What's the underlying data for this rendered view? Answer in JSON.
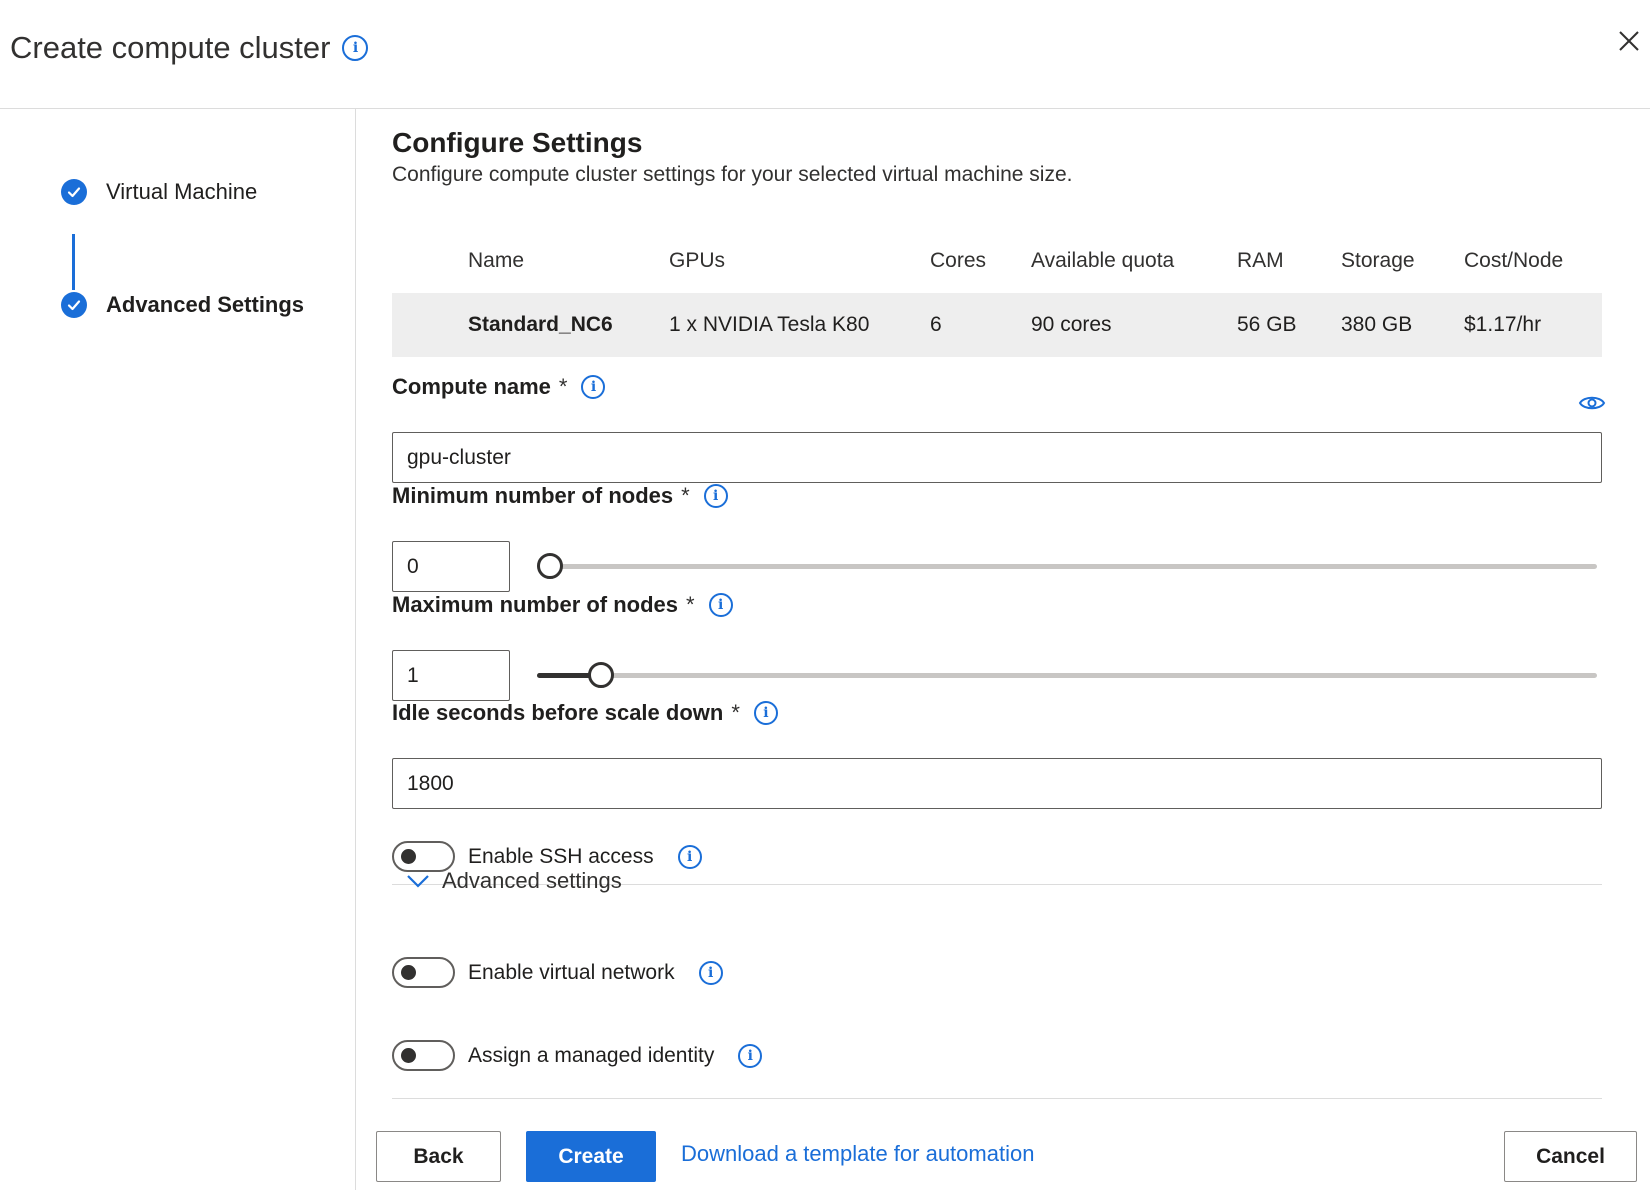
{
  "dialog": {
    "title": "Create compute cluster",
    "close_icon": "close-icon"
  },
  "steps": [
    {
      "label": "Virtual Machine",
      "status": "completed"
    },
    {
      "label": "Advanced Settings",
      "status": "completed-active"
    }
  ],
  "main": {
    "title": "Configure Settings",
    "description": "Configure compute cluster settings for your selected virtual machine size."
  },
  "vm_table": {
    "headers": {
      "name": "Name",
      "gpus": "GPUs",
      "cores": "Cores",
      "quota": "Available quota",
      "ram": "RAM",
      "storage": "Storage",
      "cost": "Cost/Node"
    },
    "row": {
      "name": "Standard_NC6",
      "gpus": "1 x NVIDIA Tesla K80",
      "cores": "6",
      "quota": "90 cores",
      "ram": "56 GB",
      "storage": "380 GB",
      "cost": "$1.17/hr"
    }
  },
  "form": {
    "compute_name": {
      "label": "Compute name",
      "required": "*",
      "value": "gpu-cluster"
    },
    "min_nodes": {
      "label": "Minimum number of nodes",
      "required": "*",
      "value": "0",
      "slider_fraction": 0
    },
    "max_nodes": {
      "label": "Maximum number of nodes",
      "required": "*",
      "value": "1",
      "slider_fraction": 0.06
    },
    "idle_seconds": {
      "label": "Idle seconds before scale down",
      "required": "*",
      "value": "1800"
    },
    "ssh": {
      "label": "Enable SSH access",
      "enabled": false
    },
    "advanced_toggle": "Advanced settings",
    "vnet": {
      "label": "Enable virtual network",
      "enabled": false
    },
    "identity": {
      "label": "Assign a managed identity",
      "enabled": false
    }
  },
  "footer": {
    "back": "Back",
    "create": "Create",
    "template_link": "Download a template for automation",
    "cancel": "Cancel"
  },
  "colors": {
    "accent": "#1a6ed8",
    "table_row_bg": "#eeeeee"
  }
}
